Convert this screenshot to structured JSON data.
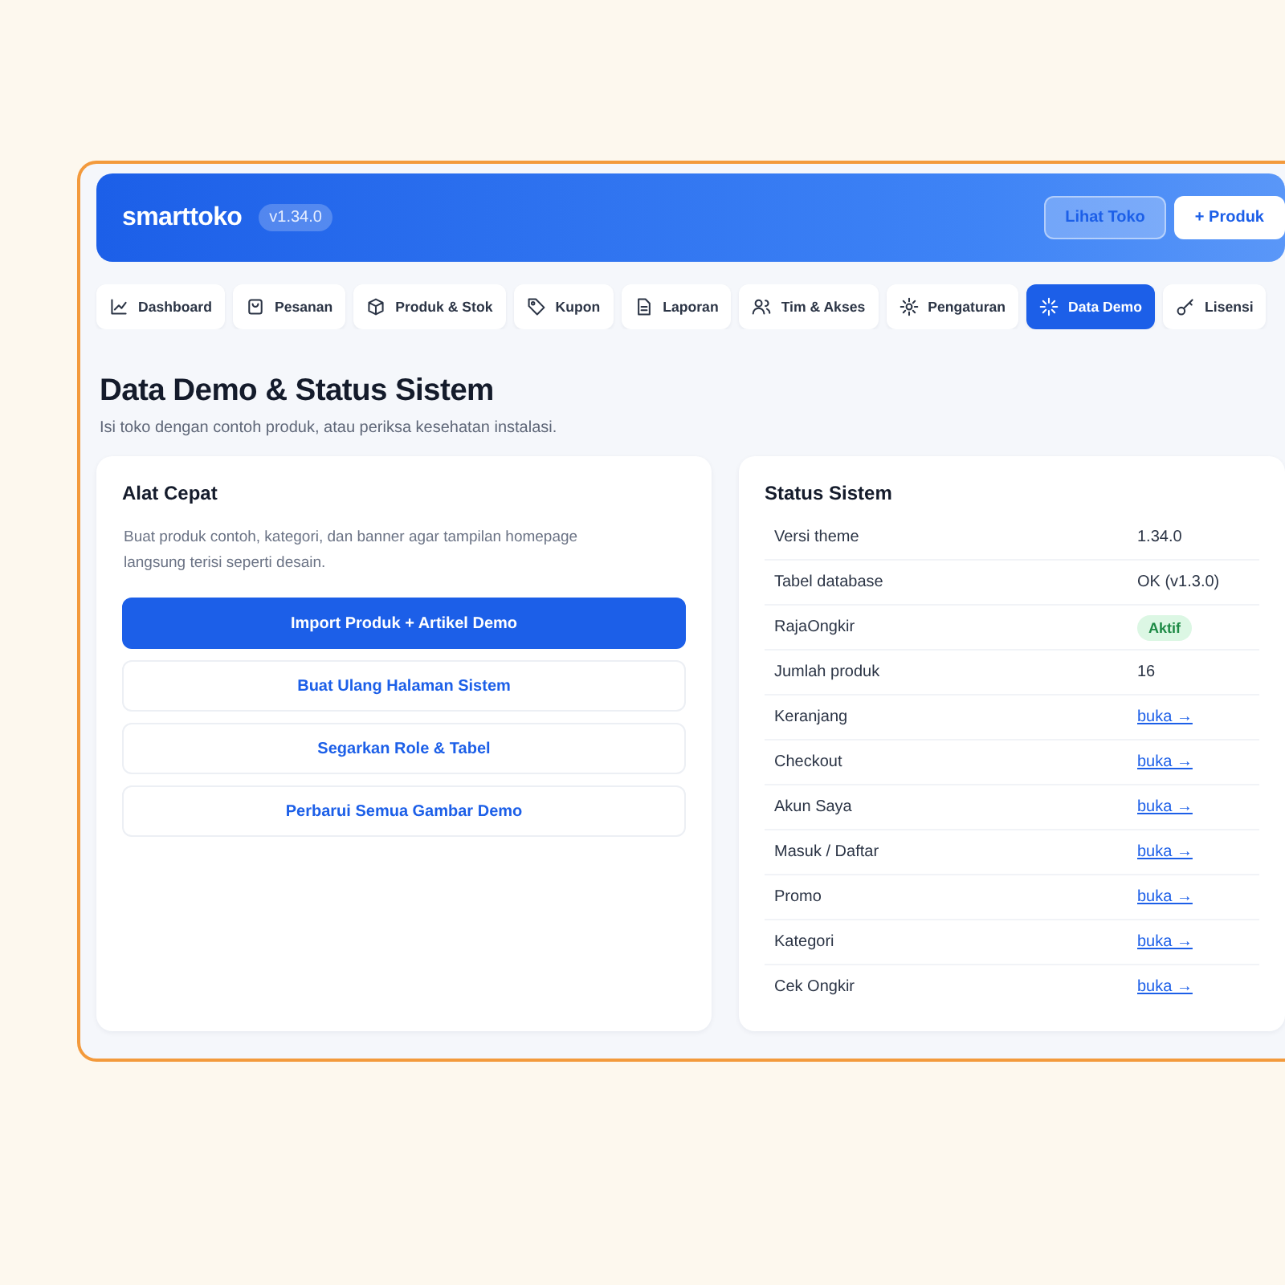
{
  "header": {
    "logo": "smarttoko",
    "version": "v1.34.0",
    "buttons": [
      {
        "label": "Lihat Toko",
        "kind": "ghost"
      },
      {
        "label": "+ Produk",
        "kind": "solid"
      }
    ]
  },
  "tabs": [
    {
      "label": "Dashboard",
      "selected": false
    },
    {
      "label": "Pesanan",
      "selected": false
    },
    {
      "label": "Produk & Stok",
      "selected": false
    },
    {
      "label": "Kupon",
      "selected": false
    },
    {
      "label": "Laporan",
      "selected": false
    },
    {
      "label": "Tim & Akses",
      "selected": false
    },
    {
      "label": "Pengaturan",
      "selected": false
    },
    {
      "label": "Data Demo",
      "selected": true
    },
    {
      "label": "Lisensi",
      "selected": false
    }
  ],
  "page": {
    "title": "Data Demo & Status Sistem",
    "subtitle": "Isi toko dengan contoh produk, atau periksa kesehatan instalasi."
  },
  "quick_tools": {
    "title": "Alat Cepat",
    "description": "Buat produk contoh, kategori, dan banner agar tampilan homepage langsung terisi seperti desain.",
    "buttons": [
      {
        "label": "Import Produk + Artikel Demo",
        "kind": "primary"
      },
      {
        "label": "Buat Ulang Halaman Sistem",
        "kind": "secondary"
      },
      {
        "label": "Segarkan Role & Tabel",
        "kind": "secondary"
      },
      {
        "label": "Perbarui Semua Gambar Demo",
        "kind": "secondary"
      }
    ]
  },
  "system_status": {
    "title": "Status Sistem",
    "rows": [
      {
        "label": "Versi theme",
        "value": "1.34.0",
        "kind": "text"
      },
      {
        "label": "Tabel database",
        "value": "OK (v1.3.0)",
        "kind": "text"
      },
      {
        "label": "RajaOngkir",
        "value": "Aktif",
        "kind": "badge"
      },
      {
        "label": "Jumlah produk",
        "value": "16",
        "kind": "text"
      },
      {
        "label": "Keranjang",
        "value": "buka →",
        "kind": "link"
      },
      {
        "label": "Checkout",
        "value": "buka →",
        "kind": "link"
      },
      {
        "label": "Akun Saya",
        "value": "buka →",
        "kind": "link"
      },
      {
        "label": "Masuk / Daftar",
        "value": "buka →",
        "kind": "link"
      },
      {
        "label": "Promo",
        "value": "buka →",
        "kind": "link"
      },
      {
        "label": "Kategori",
        "value": "buka →",
        "kind": "link"
      },
      {
        "label": "Cek Ongkir",
        "value": "buka →",
        "kind": "link"
      }
    ]
  }
}
